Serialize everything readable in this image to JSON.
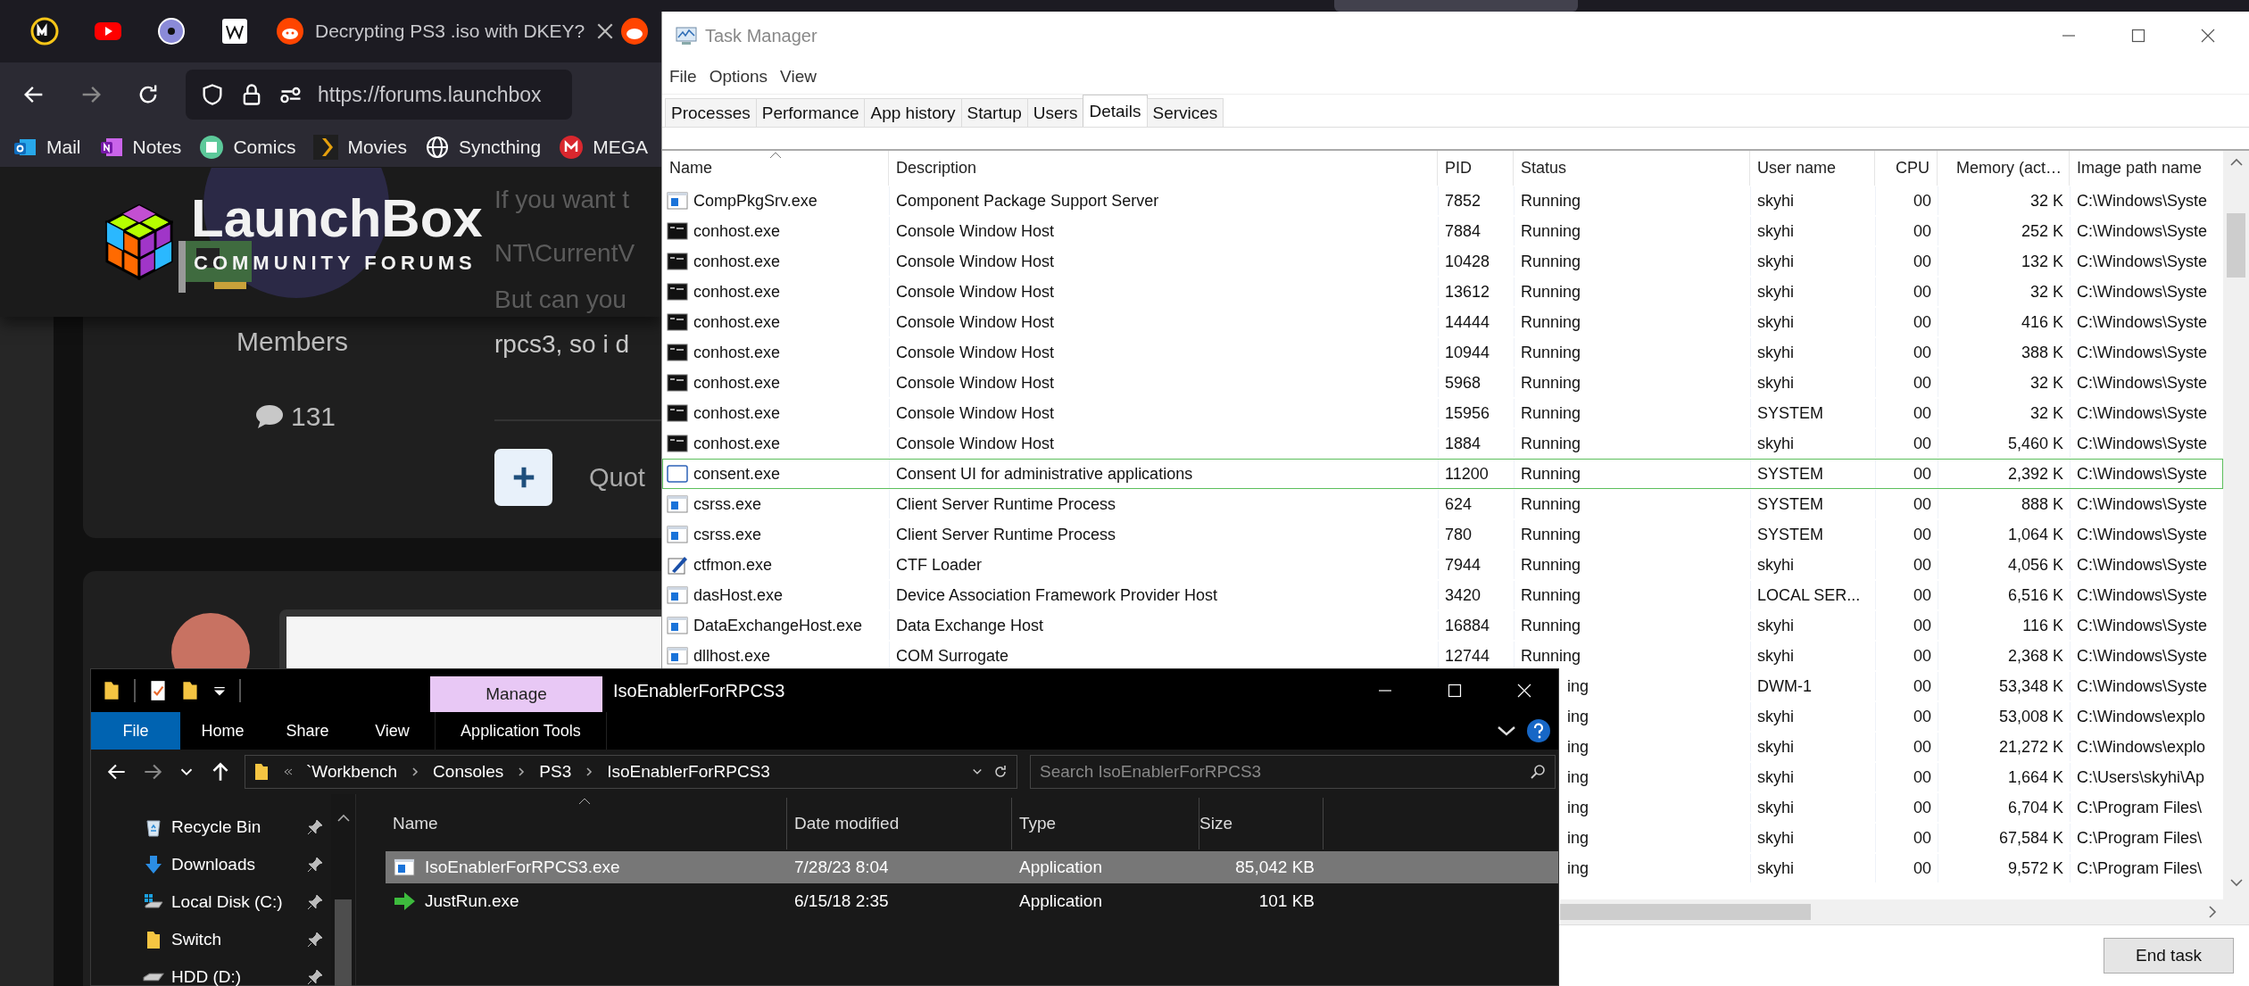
{
  "browser": {
    "tabs": [
      {
        "title": "Decrypting PS3 .iso with DKEY?"
      }
    ],
    "url": "https://forums.launchbox",
    "bookmarks": [
      {
        "label": "Mail",
        "kind": "mail"
      },
      {
        "label": "Notes",
        "kind": "notes"
      },
      {
        "label": "Comics",
        "kind": "comics"
      },
      {
        "label": "Movies",
        "kind": "movies"
      },
      {
        "label": "Syncthing",
        "kind": "globe"
      },
      {
        "label": "MEGA",
        "kind": "mega"
      }
    ],
    "site": {
      "name": "LaunchBox",
      "tagline": "COMMUNITY FORUMS"
    },
    "post": {
      "role": "Members",
      "post_count": "131",
      "lines": [
        "If you want t",
        "NT\\CurrentV",
        "But can you",
        "rpcs3, so i d"
      ],
      "quote": "Quot"
    }
  },
  "task_manager": {
    "title": "Task Manager",
    "menu": [
      "File",
      "Options",
      "View"
    ],
    "tabs": [
      {
        "label": "Processes",
        "selected": false
      },
      {
        "label": "Performance",
        "selected": false
      },
      {
        "label": "App history",
        "selected": false
      },
      {
        "label": "Startup",
        "selected": false
      },
      {
        "label": "Users",
        "selected": false
      },
      {
        "label": "Details",
        "selected": true
      },
      {
        "label": "Services",
        "selected": false
      }
    ],
    "columns": [
      {
        "label": "Name",
        "sorted": true,
        "numeric": false
      },
      {
        "label": "Description",
        "sorted": false,
        "numeric": false
      },
      {
        "label": "PID",
        "sorted": false,
        "numeric": false
      },
      {
        "label": "Status",
        "sorted": false,
        "numeric": false
      },
      {
        "label": "User name",
        "sorted": false,
        "numeric": false
      },
      {
        "label": "CPU",
        "sorted": false,
        "numeric": true
      },
      {
        "label": "Memory (act…",
        "sorted": false,
        "numeric": true
      },
      {
        "label": "Image path name",
        "sorted": false,
        "numeric": false
      }
    ],
    "rows": [
      {
        "kind": "app",
        "name": "CompPkgSrv.exe",
        "description": "Component Package Support Server",
        "pid": "7852",
        "status": "Running",
        "user": "skyhi",
        "cpu": "00",
        "memory": "32 K",
        "image_path": "C:\\Windows\\Syste",
        "selected": false
      },
      {
        "kind": "console",
        "name": "conhost.exe",
        "description": "Console Window Host",
        "pid": "7884",
        "status": "Running",
        "user": "skyhi",
        "cpu": "00",
        "memory": "252 K",
        "image_path": "C:\\Windows\\Syste",
        "selected": false
      },
      {
        "kind": "console",
        "name": "conhost.exe",
        "description": "Console Window Host",
        "pid": "10428",
        "status": "Running",
        "user": "skyhi",
        "cpu": "00",
        "memory": "132 K",
        "image_path": "C:\\Windows\\Syste",
        "selected": false
      },
      {
        "kind": "console",
        "name": "conhost.exe",
        "description": "Console Window Host",
        "pid": "13612",
        "status": "Running",
        "user": "skyhi",
        "cpu": "00",
        "memory": "32 K",
        "image_path": "C:\\Windows\\Syste",
        "selected": false
      },
      {
        "kind": "console",
        "name": "conhost.exe",
        "description": "Console Window Host",
        "pid": "14444",
        "status": "Running",
        "user": "skyhi",
        "cpu": "00",
        "memory": "416 K",
        "image_path": "C:\\Windows\\Syste",
        "selected": false
      },
      {
        "kind": "console",
        "name": "conhost.exe",
        "description": "Console Window Host",
        "pid": "10944",
        "status": "Running",
        "user": "skyhi",
        "cpu": "00",
        "memory": "388 K",
        "image_path": "C:\\Windows\\Syste",
        "selected": false
      },
      {
        "kind": "console",
        "name": "conhost.exe",
        "description": "Console Window Host",
        "pid": "5968",
        "status": "Running",
        "user": "skyhi",
        "cpu": "00",
        "memory": "32 K",
        "image_path": "C:\\Windows\\Syste",
        "selected": false
      },
      {
        "kind": "console",
        "name": "conhost.exe",
        "description": "Console Window Host",
        "pid": "15956",
        "status": "Running",
        "user": "SYSTEM",
        "cpu": "00",
        "memory": "32 K",
        "image_path": "C:\\Windows\\Syste",
        "selected": false
      },
      {
        "kind": "console",
        "name": "conhost.exe",
        "description": "Console Window Host",
        "pid": "1884",
        "status": "Running",
        "user": "skyhi",
        "cpu": "00",
        "memory": "5,460 K",
        "image_path": "C:\\Windows\\Syste",
        "selected": false
      },
      {
        "kind": "window",
        "name": "consent.exe",
        "description": "Consent UI for administrative applications",
        "pid": "11200",
        "status": "Running",
        "user": "SYSTEM",
        "cpu": "00",
        "memory": "2,392 K",
        "image_path": "C:\\Windows\\Syste",
        "selected": true
      },
      {
        "kind": "app",
        "name": "csrss.exe",
        "description": "Client Server Runtime Process",
        "pid": "624",
        "status": "Running",
        "user": "SYSTEM",
        "cpu": "00",
        "memory": "888 K",
        "image_path": "C:\\Windows\\Syste",
        "selected": false
      },
      {
        "kind": "app",
        "name": "csrss.exe",
        "description": "Client Server Runtime Process",
        "pid": "780",
        "status": "Running",
        "user": "SYSTEM",
        "cpu": "00",
        "memory": "1,064 K",
        "image_path": "C:\\Windows\\Syste",
        "selected": false
      },
      {
        "kind": "pen",
        "name": "ctfmon.exe",
        "description": "CTF Loader",
        "pid": "7944",
        "status": "Running",
        "user": "skyhi",
        "cpu": "00",
        "memory": "4,056 K",
        "image_path": "C:\\Windows\\Syste",
        "selected": false
      },
      {
        "kind": "app",
        "name": "dasHost.exe",
        "description": "Device Association Framework Provider Host",
        "pid": "3420",
        "status": "Running",
        "user": "LOCAL SER...",
        "cpu": "00",
        "memory": "6,516 K",
        "image_path": "C:\\Windows\\Syste",
        "selected": false
      },
      {
        "kind": "app",
        "name": "DataExchangeHost.exe",
        "description": "Data Exchange Host",
        "pid": "16884",
        "status": "Running",
        "user": "skyhi",
        "cpu": "00",
        "memory": "116 K",
        "image_path": "C:\\Windows\\Syste",
        "selected": false
      },
      {
        "kind": "app",
        "name": "dllhost.exe",
        "description": "COM Surrogate",
        "pid": "12744",
        "status": "Running",
        "user": "skyhi",
        "cpu": "00",
        "memory": "2,368 K",
        "image_path": "C:\\Windows\\Syste",
        "selected": false
      },
      {
        "status": "ing",
        "user": "DWM-1",
        "cpu": "00",
        "memory": "53,348 K",
        "image_path": "C:\\Windows\\Syste",
        "selected": false
      },
      {
        "status": "ing",
        "user": "skyhi",
        "cpu": "00",
        "memory": "53,008 K",
        "image_path": "C:\\Windows\\explo",
        "selected": false
      },
      {
        "status": "ing",
        "user": "skyhi",
        "cpu": "00",
        "memory": "21,272 K",
        "image_path": "C:\\Windows\\explo",
        "selected": false
      },
      {
        "status": "ing",
        "user": "skyhi",
        "cpu": "00",
        "memory": "1,664 K",
        "image_path": "C:\\Users\\skyhi\\Ap",
        "selected": false
      },
      {
        "status": "ing",
        "user": "skyhi",
        "cpu": "00",
        "memory": "6,704 K",
        "image_path": "C:\\Program Files\\",
        "selected": false
      },
      {
        "status": "ing",
        "user": "skyhi",
        "cpu": "00",
        "memory": "67,584 K",
        "image_path": "C:\\Program Files\\",
        "selected": false
      },
      {
        "status": "ing",
        "user": "skyhi",
        "cpu": "00",
        "memory": "9,572 K",
        "image_path": "C:\\Program Files\\",
        "selected": false
      }
    ],
    "button": "End task"
  },
  "explorer": {
    "title": "IsoEnablerForRPCS3",
    "ribbon_tabs": [
      {
        "label": "File",
        "kind": "file"
      },
      {
        "label": "Home",
        "kind": "tab"
      },
      {
        "label": "Share",
        "kind": "tab"
      },
      {
        "label": "View",
        "kind": "tab"
      },
      {
        "label": "Application Tools",
        "kind": "contextual",
        "group": "Manage"
      }
    ],
    "breadcrumbs": [
      "`Workbench",
      "Consoles",
      "PS3",
      "IsoEnablerForRPCS3"
    ],
    "search": {
      "placeholder": "Search IsoEnablerForRPCS3"
    },
    "nav": [
      {
        "label": "Recycle Bin",
        "kind": "recycle",
        "pinned": true
      },
      {
        "label": "Downloads",
        "kind": "download",
        "pinned": true
      },
      {
        "label": "Local Disk (C:)",
        "kind": "drive-windows",
        "pinned": true
      },
      {
        "label": "Switch",
        "kind": "folder",
        "pinned": true
      },
      {
        "label": "HDD (D:)",
        "kind": "drive",
        "pinned": true
      }
    ],
    "columns": [
      "Name",
      "Date modified",
      "Type",
      "Size"
    ],
    "files": [
      {
        "kind": "app",
        "name": "IsoEnablerForRPCS3.exe",
        "date": "7/28/23 8:04",
        "type": "Application",
        "size": "85,042 KB",
        "selected": true
      },
      {
        "kind": "arrow",
        "name": "JustRun.exe",
        "date": "6/15/18 2:35",
        "type": "Application",
        "size": "101 KB",
        "selected": false
      }
    ]
  }
}
